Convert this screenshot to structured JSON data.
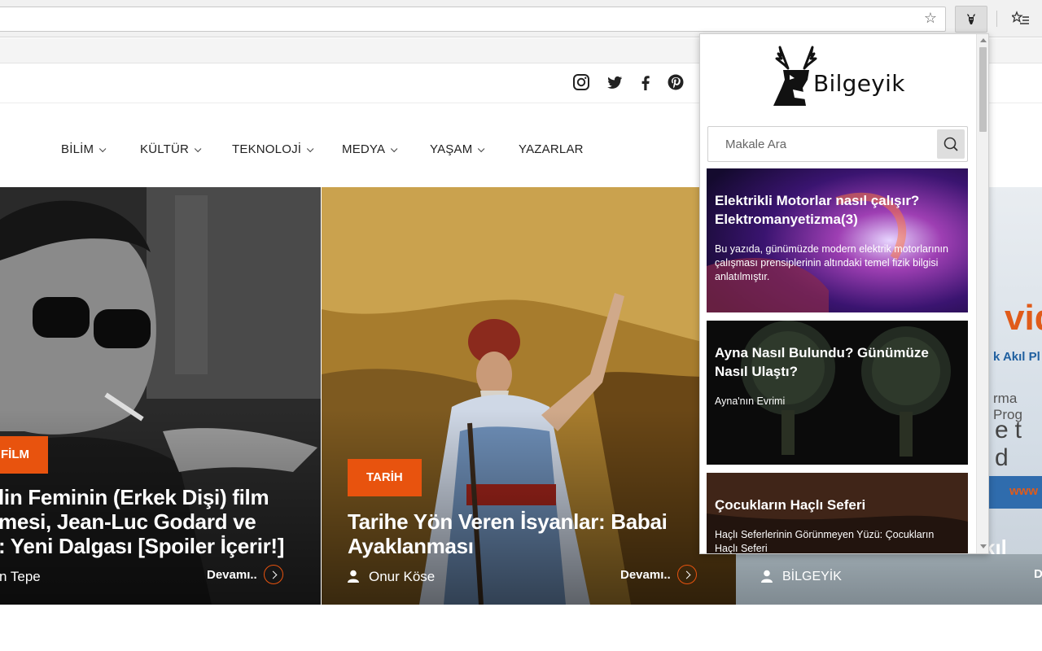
{
  "browser": {
    "bookmark_icon": "star-icon",
    "extension_icon": "deer-icon",
    "menu_icon": "bookmarks-list-icon"
  },
  "social": {
    "icons": [
      "instagram-icon",
      "twitter-icon",
      "facebook-icon",
      "pinterest-icon"
    ]
  },
  "nav": {
    "items": [
      "BİLİM",
      "KÜLTÜR",
      "TEKNOLOJİ",
      "MEDYA",
      "YAŞAM",
      "YAZARLAR"
    ]
  },
  "slides": [
    {
      "category": "FİLM",
      "title_lines": [
        "lin Feminin (Erkek Dişi) film",
        "mesi, Jean-Luc Godard ve",
        ": Yeni Dalgası [Spoiler İçerir!]"
      ],
      "author": "n Tepe",
      "more": "Devamı.."
    },
    {
      "category": "TARİH",
      "title_lines": [
        "Tarihe Yön Veren İsyanlar: Babai",
        "Ayaklanması"
      ],
      "author": "Onur Köse",
      "more": "Devamı.."
    },
    {
      "ad_texts": [
        "vid",
        "k Akıl Pl",
        "rma Prog",
        "et d",
        "www",
        "kıl Pla"
      ],
      "author": "BİLGEYİK",
      "more": "D"
    }
  ],
  "popup": {
    "brand": "Bilgeyik",
    "search_placeholder": "Makale Ara",
    "articles": [
      {
        "title": "Elektrikli Motorlar nasıl çalışır? Elektromanyetizma(3)",
        "summary": "Bu yazıda, günümüzde modern elektrik motorlarının çalışması prensiplerinin altındaki temel fizik bilgisi anlatılmıştır."
      },
      {
        "title": "Ayna Nasıl Bulundu? Günümüze Nasıl Ulaştı?",
        "summary": "Ayna'nın Evrimi"
      },
      {
        "title": "Çocukların Haçlı Seferi",
        "summary": "Haçlı Seferlerinin Görünmeyen Yüzü: Çocukların Haçlı Seferi"
      }
    ]
  },
  "colors": {
    "accent": "#e8530e"
  }
}
